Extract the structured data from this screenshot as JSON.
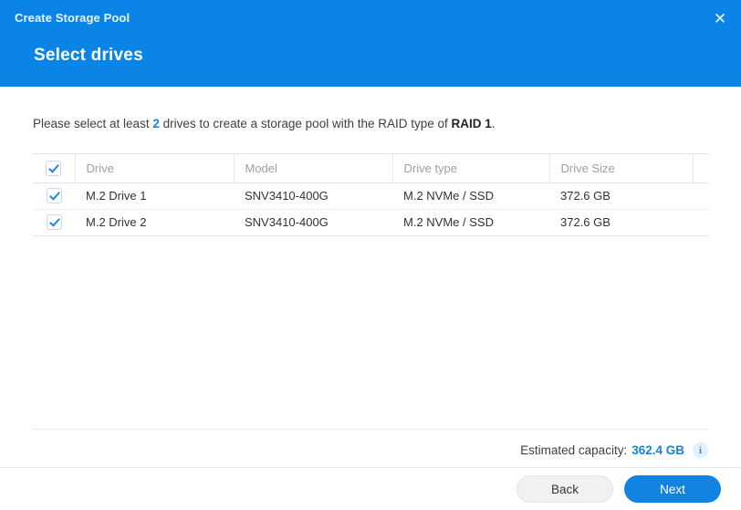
{
  "dialog": {
    "title": "Create Storage Pool",
    "close_icon": "close-icon",
    "step_title": "Select drives"
  },
  "instruction": {
    "prefix": "Please select at least ",
    "min_drives": "2",
    "middle": " drives to create a storage pool with the RAID type of ",
    "raid_type": "RAID 1",
    "suffix": "."
  },
  "table": {
    "select_all_checked": true,
    "columns": [
      {
        "key": "check",
        "label": ""
      },
      {
        "key": "drive",
        "label": "Drive"
      },
      {
        "key": "model",
        "label": "Model"
      },
      {
        "key": "type",
        "label": "Drive type"
      },
      {
        "key": "size",
        "label": "Drive Size"
      },
      {
        "key": "extra",
        "label": ""
      }
    ],
    "rows": [
      {
        "checked": true,
        "drive": "M.2 Drive 1",
        "model": "SNV3410-400G",
        "type": "M.2 NVMe / SSD",
        "size": "372.6 GB"
      },
      {
        "checked": true,
        "drive": "M.2 Drive 2",
        "model": "SNV3410-400G",
        "type": "M.2 NVMe / SSD",
        "size": "372.6 GB"
      }
    ]
  },
  "capacity": {
    "label": "Estimated capacity:",
    "value": "362.4 GB",
    "info_icon_glyph": "i"
  },
  "buttons": {
    "back": "Back",
    "next": "Next"
  },
  "colors": {
    "header_blue": "#0b84e8",
    "accent_blue": "#1283e0",
    "text_dark": "#2f3336",
    "header_text_gray": "#9aa0a6"
  }
}
